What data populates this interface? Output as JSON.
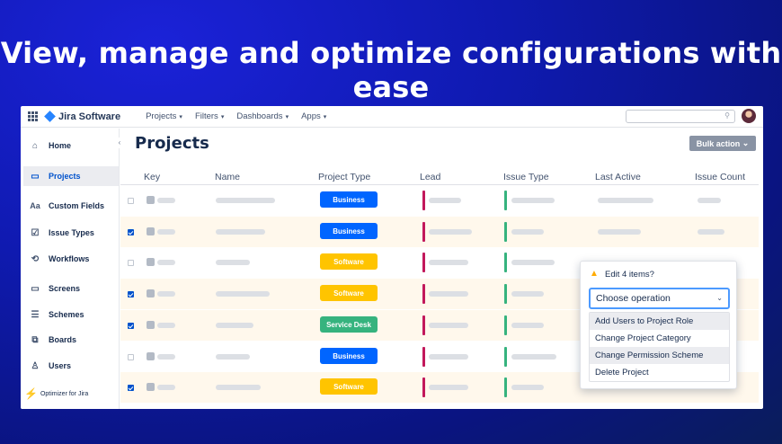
{
  "headline": "View, manage and optimize configurations with ease",
  "app": {
    "logo_text": "Jira Software",
    "nav": [
      "Projects",
      "Filters",
      "Dashboards",
      "Apps"
    ],
    "search_icon": "search-icon"
  },
  "sidebar": {
    "items": [
      {
        "label": "Home",
        "icon": "home-icon"
      },
      {
        "label": "Projects",
        "icon": "folder-icon",
        "active": true
      },
      {
        "label": "Custom Fields",
        "icon": "text-field-icon"
      },
      {
        "label": "Issue Types",
        "icon": "checkbox-icon"
      },
      {
        "label": "Workflows",
        "icon": "workflow-icon"
      },
      {
        "label": "Screens",
        "icon": "screen-icon"
      },
      {
        "label": "Schemes",
        "icon": "list-icon"
      },
      {
        "label": "Boards",
        "icon": "board-icon"
      },
      {
        "label": "Users",
        "icon": "user-icon"
      }
    ],
    "footer": "Optimizer for Jira"
  },
  "main": {
    "title": "Projects",
    "bulk_action": "Bulk action",
    "columns": [
      "Key",
      "Name",
      "Project Type",
      "Lead",
      "Issue Type",
      "Last Active",
      "Issue Count"
    ],
    "rows": [
      {
        "checked": false,
        "type": "Business"
      },
      {
        "checked": true,
        "type": "Business"
      },
      {
        "checked": false,
        "type": "Software"
      },
      {
        "checked": true,
        "type": "Software"
      },
      {
        "checked": true,
        "type": "Service Desk"
      },
      {
        "checked": false,
        "type": "Business"
      },
      {
        "checked": true,
        "type": "Software"
      }
    ]
  },
  "popup": {
    "title": "Edit 4 items?",
    "select_value": "Choose operation",
    "options": [
      "Add Users to Project Role",
      "Change Project Category",
      "Change Permission Scheme",
      "Delete Project"
    ]
  },
  "colors": {
    "Business": "#0065ff",
    "Software": "#ffc400",
    "Service Desk": "#36b37e"
  }
}
